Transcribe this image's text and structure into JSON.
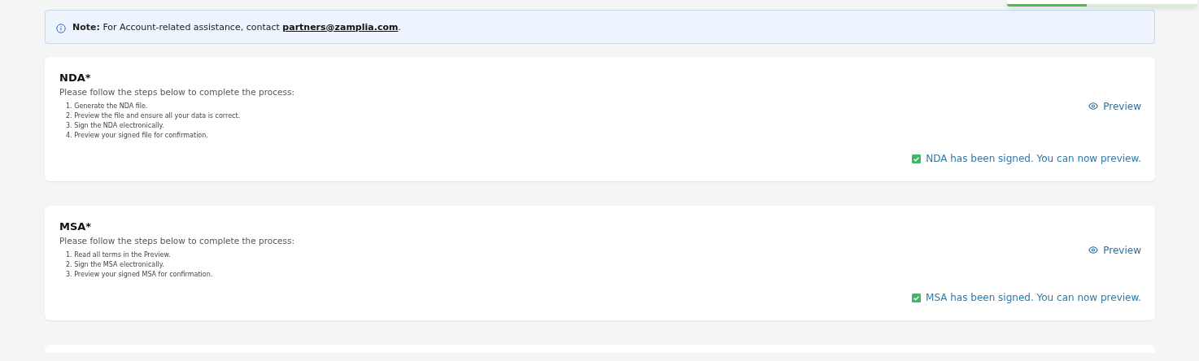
{
  "toast": {
    "level": 0.42
  },
  "note": {
    "text": "**Note:** For Account-related assistance, contact ",
    "link": "partners@zamplia.com",
    "after": "."
  },
  "documents": [
    {
      "title": "NDA*",
      "intro": "Please follow the steps below to complete the process:",
      "steps": [
        "1. Generate the NDA file.",
        "2. Preview the file and ensure all your data is correct.",
        "3. Sign the NDA electronically.",
        "4. Preview your signed file for confirmation."
      ],
      "preview": "Preview",
      "signed": true,
      "status": "NDA has been signed. You can now preview."
    },
    {
      "title": "MSA*",
      "intro": "Please follow the steps below to complete the process:",
      "steps": [
        "1. Read all terms in the Preview.",
        "2. Sign the MSA electronically.",
        "3. Preview your signed MSA for confirmation."
      ],
      "preview": "Preview",
      "signed": true,
      "status": "MSA has been signed. You can now preview."
    }
  ]
}
